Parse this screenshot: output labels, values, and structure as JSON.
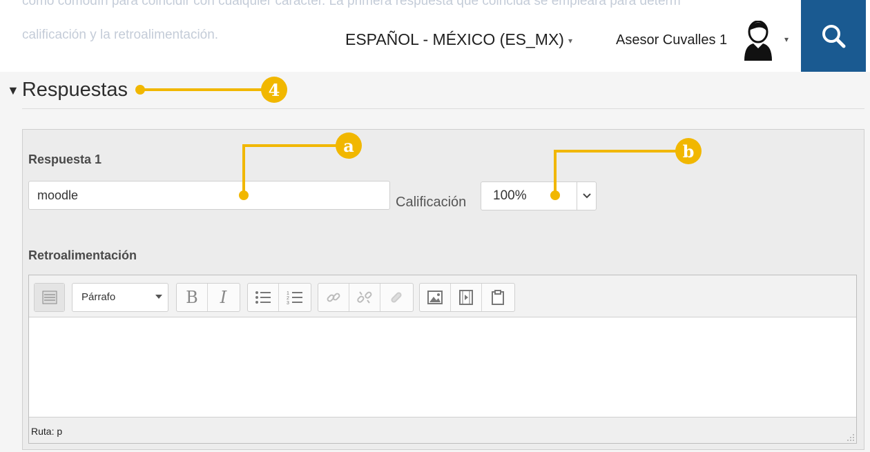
{
  "header": {
    "background_text": [
      "como comodín para coincidir con cualquier caracter. La primera respuesta que coincida se empleará para determ",
      "calificación y la retroalimentación."
    ],
    "language": "ESPAÑOL - MÉXICO (ES_MX)",
    "user_name": "Asesor Cuvalles 1",
    "icons": {
      "avatar": "user-avatar-icon",
      "search": "search-icon",
      "dropdown": "caret-down-icon"
    },
    "accent_color": "#1a5a91"
  },
  "section": {
    "title": "Respuestas",
    "answer": {
      "label": "Respuesta 1",
      "value": "moodle",
      "grade_label": "Calificación",
      "grade_value": "100%"
    },
    "feedback": {
      "label": "Retroalimentación",
      "format": "Párrafo",
      "path_label": "Ruta: p",
      "toolbar_icons": [
        "toolbar-toggle-icon",
        "bold-icon",
        "italic-icon",
        "bullet-list-icon",
        "numbered-list-icon",
        "link-icon",
        "unlink-icon",
        "anchor-icon",
        "image-icon",
        "media-icon",
        "paste-icon"
      ]
    }
  },
  "callouts": {
    "section": "4",
    "answer": "a",
    "grade": "b",
    "color": "#f1b700"
  }
}
